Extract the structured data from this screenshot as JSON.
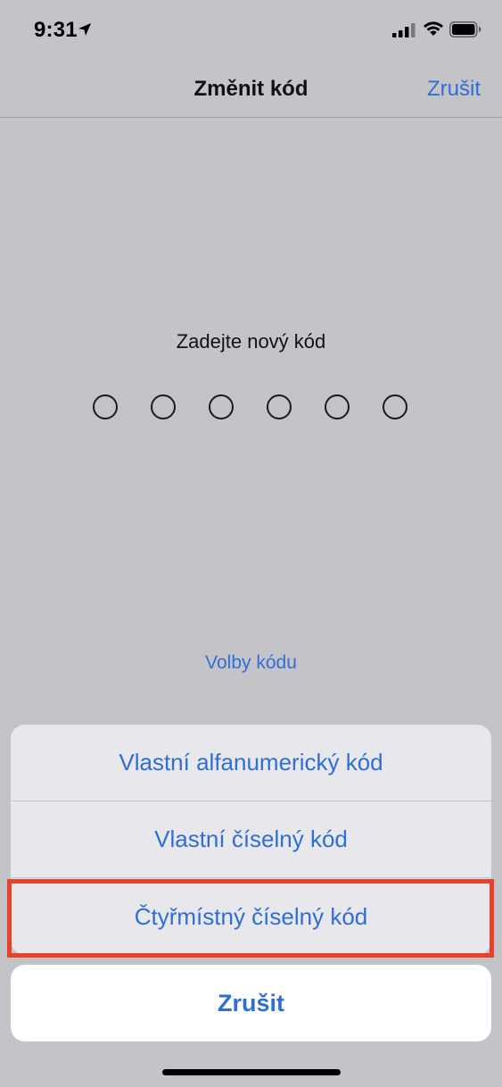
{
  "status_bar": {
    "time": "9:31",
    "icons": [
      "location-arrow-icon",
      "cellular-signal-icon",
      "wifi-icon",
      "battery-icon"
    ]
  },
  "nav": {
    "title": "Změnit kód",
    "cancel_label": "Zrušit"
  },
  "passcode": {
    "prompt": "Zadejte nový kód",
    "digits_total": 6,
    "digits_entered": 0,
    "options_label": "Volby kódu"
  },
  "action_sheet": {
    "items": [
      {
        "label": "Vlastní alfanumerický kód"
      },
      {
        "label": "Vlastní číselný kód"
      },
      {
        "label": "Čtyřmístný číselný kód"
      }
    ],
    "cancel_label": "Zrušit"
  },
  "colors": {
    "accent": "#2f6fd3",
    "highlight": "#e8402a",
    "background": "#c4c3c8"
  }
}
